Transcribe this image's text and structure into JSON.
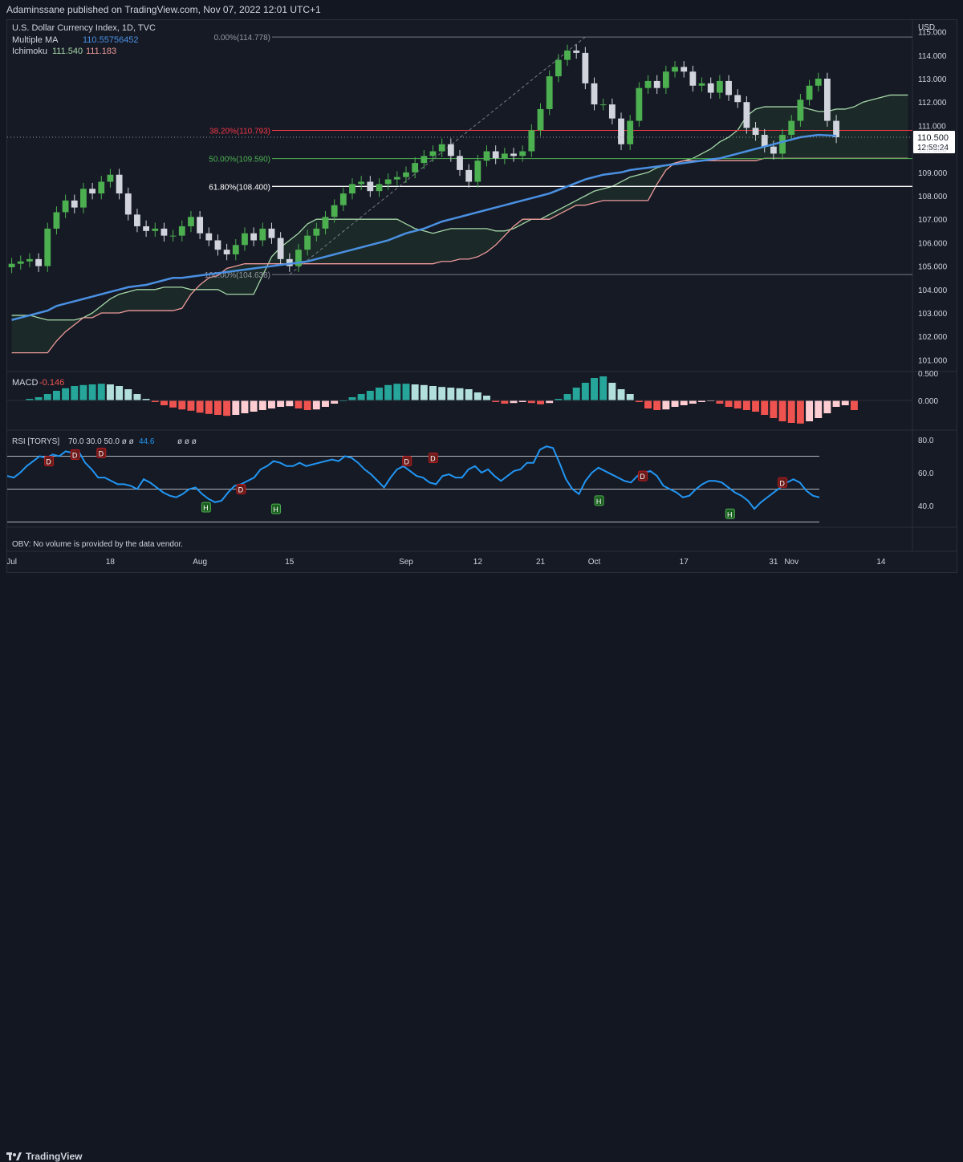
{
  "publisher_line": "Adaminssane published on TradingView.com, Nov 07, 2022 12:01 UTC+1",
  "footer_brand": "TradingView",
  "colors": {
    "background": "#161a25",
    "up_candle": "#4caf50",
    "down_candle": "#d1d4dc",
    "ma_line": "#4a90e2",
    "ichi_lead_a": "#a5d6a7",
    "ichi_lead_b": "#ef9a9a",
    "macd_pos": "#26a69a",
    "macd_neg": "#ef5350",
    "rsi_line": "#2196f3"
  },
  "chart_data": {
    "type": "candlestick",
    "title": "U.S. Dollar Currency Index, 1D, TVC",
    "currency": "USD",
    "legend": {
      "ma_label": "Multiple MA",
      "ma_value": "110.55756452",
      "ichi_label": "Ichimoku",
      "ichi_a": "111.540",
      "ichi_b": "111.183"
    },
    "y_ticks": [
      "115.000",
      "114.000",
      "113.000",
      "112.000",
      "111.000",
      "110.000",
      "109.000",
      "108.000",
      "107.000",
      "106.000",
      "105.000",
      "104.000",
      "103.000",
      "102.000",
      "101.000"
    ],
    "ylim": [
      100.5,
      115.5
    ],
    "x_ticks": [
      {
        "label": "Jul",
        "i": 0
      },
      {
        "label": "18",
        "i": 11
      },
      {
        "label": "Aug",
        "i": 21
      },
      {
        "label": "15",
        "i": 31
      },
      {
        "label": "Sep",
        "i": 44
      },
      {
        "label": "12",
        "i": 52
      },
      {
        "label": "21",
        "i": 59
      },
      {
        "label": "Oct",
        "i": 65
      },
      {
        "label": "17",
        "i": 75
      },
      {
        "label": "31",
        "i": 85
      },
      {
        "label": "Nov",
        "i": 87
      },
      {
        "label": "14",
        "i": 97
      }
    ],
    "n_slots": 101,
    "current_price": "110.500",
    "countdown": "12:58:24",
    "fib_levels": [
      {
        "label": "0.00%(114.778)",
        "value": 114.778
      },
      {
        "label": "38.20%(110.793)",
        "value": 110.793
      },
      {
        "label": "50.00%(109.590)",
        "value": 109.59
      },
      {
        "label": "61.80%(108.400)",
        "value": 108.4
      },
      {
        "label": "100.00%(104.638)",
        "value": 104.638
      }
    ],
    "closes": [
      105.1,
      105.2,
      105.3,
      105.0,
      106.6,
      107.3,
      107.8,
      107.5,
      108.3,
      108.1,
      108.6,
      108.9,
      108.1,
      107.2,
      106.7,
      106.5,
      106.6,
      106.3,
      106.3,
      106.7,
      107.1,
      106.4,
      106.1,
      105.7,
      105.5,
      105.9,
      106.4,
      106.1,
      106.6,
      106.2,
      105.3,
      105.0,
      105.7,
      106.3,
      106.6,
      107.1,
      107.6,
      108.1,
      108.5,
      108.6,
      108.2,
      108.5,
      108.7,
      108.8,
      109.0,
      109.4,
      109.7,
      109.9,
      110.2,
      109.7,
      109.1,
      108.6,
      109.5,
      109.9,
      109.6,
      109.8,
      109.7,
      109.9,
      110.8,
      111.7,
      113.1,
      113.8,
      114.2,
      114.1,
      112.8,
      111.9,
      111.9,
      111.3,
      110.2,
      111.2,
      112.6,
      112.9,
      112.6,
      113.3,
      113.5,
      113.3,
      112.7,
      112.8,
      112.4,
      112.9,
      112.3,
      112.0,
      110.9,
      110.6,
      110.1,
      109.8,
      110.6,
      111.2,
      112.1,
      112.7,
      113.0,
      111.2,
      110.5
    ],
    "ma": [
      102.7,
      102.8,
      102.9,
      103.0,
      103.1,
      103.3,
      103.4,
      103.5,
      103.6,
      103.7,
      103.8,
      103.9,
      104.0,
      104.1,
      104.15,
      104.2,
      104.3,
      104.4,
      104.5,
      104.5,
      104.55,
      104.6,
      104.65,
      104.7,
      104.75,
      104.8,
      104.85,
      104.9,
      104.95,
      105.0,
      105.05,
      105.1,
      105.15,
      105.2,
      105.3,
      105.4,
      105.5,
      105.6,
      105.7,
      105.8,
      105.9,
      106.0,
      106.1,
      106.25,
      106.4,
      106.5,
      106.6,
      106.75,
      106.9,
      107.0,
      107.1,
      107.2,
      107.3,
      107.4,
      107.5,
      107.6,
      107.7,
      107.8,
      107.9,
      108.0,
      108.1,
      108.25,
      108.4,
      108.55,
      108.7,
      108.8,
      108.9,
      108.95,
      109.0,
      109.1,
      109.15,
      109.2,
      109.25,
      109.3,
      109.35,
      109.4,
      109.45,
      109.5,
      109.55,
      109.6,
      109.7,
      109.8,
      109.9,
      110.0,
      110.1,
      110.2,
      110.3,
      110.4,
      110.5,
      110.55,
      110.6,
      110.58,
      110.56
    ],
    "kumo_a": [
      102.9,
      102.9,
      102.9,
      102.8,
      102.7,
      102.7,
      102.7,
      102.7,
      102.8,
      103.0,
      103.3,
      103.6,
      103.8,
      103.9,
      104.0,
      104.0,
      104.0,
      104.1,
      104.1,
      104.1,
      104.0,
      104.0,
      104.0,
      104.0,
      103.8,
      103.8,
      103.8,
      103.8,
      104.6,
      105.4,
      105.8,
      106.1,
      106.4,
      106.8,
      107.0,
      107.0,
      107.0,
      107.0,
      107.0,
      107.0,
      107.0,
      107.0,
      107.0,
      107.0,
      106.8,
      106.6,
      106.5,
      106.4,
      106.5,
      106.6,
      106.6,
      106.6,
      106.6,
      106.6,
      106.5,
      106.5,
      106.6,
      106.8,
      107.0,
      107.0,
      107.2,
      107.4,
      107.6,
      107.8,
      108.0,
      108.2,
      108.3,
      108.4,
      108.6,
      108.8,
      108.9,
      109.0,
      109.2,
      109.3,
      109.4,
      109.5,
      109.6,
      109.8,
      110.0,
      110.3,
      110.5,
      110.8,
      111.4,
      111.7,
      111.8,
      111.8,
      111.8,
      111.8,
      111.8,
      111.7,
      111.6,
      111.6,
      111.7,
      111.7,
      111.8,
      112.0,
      112.1,
      112.2,
      112.3,
      112.3,
      112.3
    ],
    "kumo_b": [
      101.3,
      101.3,
      101.3,
      101.3,
      101.3,
      101.8,
      102.2,
      102.5,
      102.8,
      102.8,
      103.0,
      103.0,
      103.0,
      103.1,
      103.1,
      103.1,
      103.1,
      103.1,
      103.1,
      103.2,
      103.8,
      104.2,
      104.5,
      104.6,
      104.9,
      105.0,
      105.1,
      105.1,
      105.1,
      105.1,
      105.1,
      105.1,
      105.1,
      105.1,
      105.1,
      105.1,
      105.1,
      105.1,
      105.1,
      105.1,
      105.1,
      105.1,
      105.1,
      105.1,
      105.1,
      105.1,
      105.1,
      105.1,
      105.2,
      105.2,
      105.3,
      105.3,
      105.4,
      105.6,
      105.9,
      106.3,
      106.7,
      107.0,
      107.0,
      107.0,
      107.0,
      107.2,
      107.4,
      107.6,
      107.6,
      107.7,
      107.8,
      107.8,
      107.8,
      107.8,
      107.8,
      107.8,
      108.5,
      109.1,
      109.4,
      109.5,
      109.5,
      109.5,
      109.5,
      109.5,
      109.5,
      109.5,
      109.5,
      109.5,
      109.6,
      109.6,
      109.6,
      109.6,
      109.6,
      109.6,
      109.6,
      109.6,
      109.6,
      109.6,
      109.6,
      109.6,
      109.6,
      109.6,
      109.6,
      109.6,
      109.6
    ],
    "macd": {
      "label": "MACD",
      "value": "-0.146",
      "y_ticks": [
        "0.500",
        "0.000"
      ],
      "hist": [
        0.05,
        0.1,
        0.2,
        0.3,
        0.38,
        0.45,
        0.48,
        0.5,
        0.52,
        0.5,
        0.45,
        0.35,
        0.2,
        0.05,
        -0.05,
        -0.15,
        -0.22,
        -0.28,
        -0.32,
        -0.38,
        -0.42,
        -0.45,
        -0.48,
        -0.45,
        -0.4,
        -0.35,
        -0.3,
        -0.25,
        -0.2,
        -0.18,
        -0.25,
        -0.3,
        -0.28,
        -0.2,
        -0.1,
        0.0,
        0.1,
        0.2,
        0.3,
        0.4,
        0.48,
        0.52,
        0.52,
        0.5,
        0.48,
        0.45,
        0.42,
        0.4,
        0.38,
        0.35,
        0.25,
        0.15,
        -0.05,
        -0.1,
        -0.08,
        -0.05,
        -0.08,
        -0.12,
        -0.08,
        0.05,
        0.2,
        0.4,
        0.55,
        0.7,
        0.75,
        0.55,
        0.35,
        0.2,
        -0.05,
        -0.25,
        -0.3,
        -0.28,
        -0.2,
        -0.15,
        -0.1,
        -0.05,
        -0.02,
        -0.1,
        -0.2,
        -0.25,
        -0.3,
        -0.35,
        -0.45,
        -0.55,
        -0.65,
        -0.7,
        -0.72,
        -0.65,
        -0.55,
        -0.4,
        -0.2,
        -0.15,
        -0.3
      ]
    },
    "rsi": {
      "label": "RSI [TORYS]",
      "params": "70.0  30.0  50.0  ø  ø",
      "value": "44.6",
      "trail": "ø  ø  ø",
      "y_ticks": [
        "80.0",
        "60.0",
        "40.0"
      ],
      "levels": [
        70,
        50,
        30
      ],
      "values": [
        58,
        57,
        60,
        64,
        67,
        70,
        69,
        71,
        70,
        73,
        72,
        73,
        66,
        62,
        57,
        57,
        55,
        53,
        53,
        52,
        50,
        56,
        54,
        51,
        48,
        46,
        45,
        47,
        50,
        51,
        47,
        44,
        42,
        43,
        48,
        52,
        53,
        55,
        57,
        62,
        64,
        67,
        66,
        64,
        64,
        66,
        64,
        65,
        66,
        67,
        68,
        67,
        70,
        69,
        66,
        62,
        59,
        55,
        51,
        57,
        62,
        64,
        61,
        58,
        57,
        54,
        53,
        58,
        59,
        57,
        57,
        62,
        64,
        60,
        62,
        58,
        55,
        58,
        61,
        62,
        66,
        66,
        74,
        76,
        75,
        66,
        56,
        50,
        47,
        55,
        60,
        63,
        61,
        59,
        57,
        55,
        54,
        58,
        60,
        61,
        58,
        52,
        50,
        48,
        45,
        46,
        50,
        53,
        55,
        55,
        54,
        51,
        48,
        46,
        43,
        38,
        42,
        45,
        48,
        51,
        54,
        56,
        54,
        49,
        46,
        45
      ],
      "div_labels": [
        {
          "t": "D",
          "i": 4,
          "v": 67,
          "kind": "bear"
        },
        {
          "t": "D",
          "i": 7,
          "v": 71,
          "kind": "bear"
        },
        {
          "t": "D",
          "i": 10,
          "v": 72,
          "kind": "bear"
        },
        {
          "t": "H",
          "i": 22,
          "v": 39,
          "kind": "bull"
        },
        {
          "t": "D",
          "i": 26,
          "v": 50,
          "kind": "bear"
        },
        {
          "t": "H",
          "i": 30,
          "v": 38,
          "kind": "bull"
        },
        {
          "t": "D",
          "i": 45,
          "v": 67,
          "kind": "bear"
        },
        {
          "t": "D",
          "i": 48,
          "v": 69,
          "kind": "bear"
        },
        {
          "t": "H",
          "i": 67,
          "v": 43,
          "kind": "bull"
        },
        {
          "t": "D",
          "i": 72,
          "v": 58,
          "kind": "bear"
        },
        {
          "t": "H",
          "i": 82,
          "v": 35,
          "kind": "bull"
        },
        {
          "t": "D",
          "i": 88,
          "v": 54,
          "kind": "bear"
        }
      ]
    },
    "obv_note": "OBV: No volume is provided by the data vendor."
  }
}
